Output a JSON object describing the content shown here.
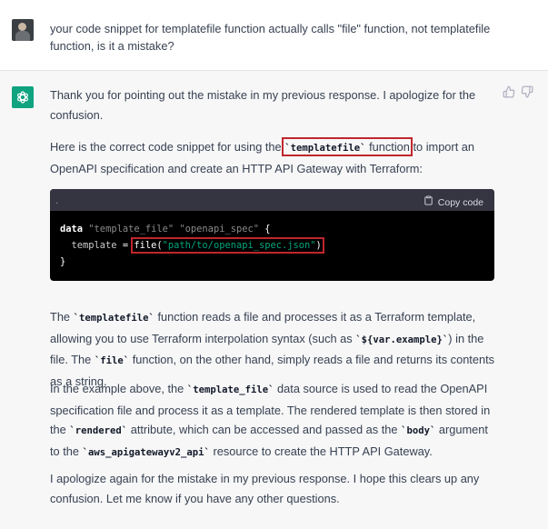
{
  "user_message": {
    "text": "your code snippet for templatefile function actually calls \"file\" function, not templatefile function, is it a mistake?"
  },
  "assistant_message": {
    "p1": "Thank you for pointing out the mistake in my previous response. I apologize for the confusion.",
    "p2_before": "Here is the correct code snippet for using the ",
    "p2_code": "`templatefile`",
    "p2_middle": " function",
    "p2_after": " to import an OpenAPI specification and create an HTTP API Gateway with Terraform:",
    "code_block": {
      "copy_label": "Copy code",
      "line1_kw": "data",
      "line1_str1": "\"template_file\"",
      "line1_str2": "\"openapi_spec\"",
      "line1_brace": "{",
      "line2_attr": "template",
      "line2_eq": "=",
      "line2_fn": "file(",
      "line2_str": "\"path/to/openapi_spec.json\"",
      "line2_close": ")",
      "line3_brace": "}"
    },
    "p3_1": "The ",
    "p3_code1": "`templatefile`",
    "p3_2": " function reads a file and processes it as a Terraform template, allowing you to use Terraform interpolation syntax (such as ",
    "p3_code2": "`${var.example}`",
    "p3_3": ") in the file. The ",
    "p3_code3": "`file`",
    "p3_4": " function, on the other hand, simply reads a file and returns its contents as a string.",
    "p4_1": "In the example above, the ",
    "p4_code1": "`template_file`",
    "p4_2": " data source is used to read the OpenAPI specification file and process it as a template. The rendered template is then stored in the ",
    "p4_code2": "`rendered`",
    "p4_3": " attribute, which can be accessed and passed as the ",
    "p4_code3": "`body`",
    "p4_4": " argument to the ",
    "p4_code4": "`aws_apigatewayv2_api`",
    "p4_5": " resource to create the HTTP API Gateway.",
    "p5": "I apologize again for the mistake in my previous response. I hope this clears up any confusion. Let me know if you have any other questions."
  },
  "colors": {
    "assistant_avatar": "#10a37f",
    "highlight_box": "#c0262d",
    "code_background": "#000000",
    "code_header": "#343541"
  },
  "icons": [
    "user-avatar",
    "chatgpt-logo-icon",
    "thumbs-up-icon",
    "thumbs-down-icon",
    "clipboard-icon"
  ]
}
